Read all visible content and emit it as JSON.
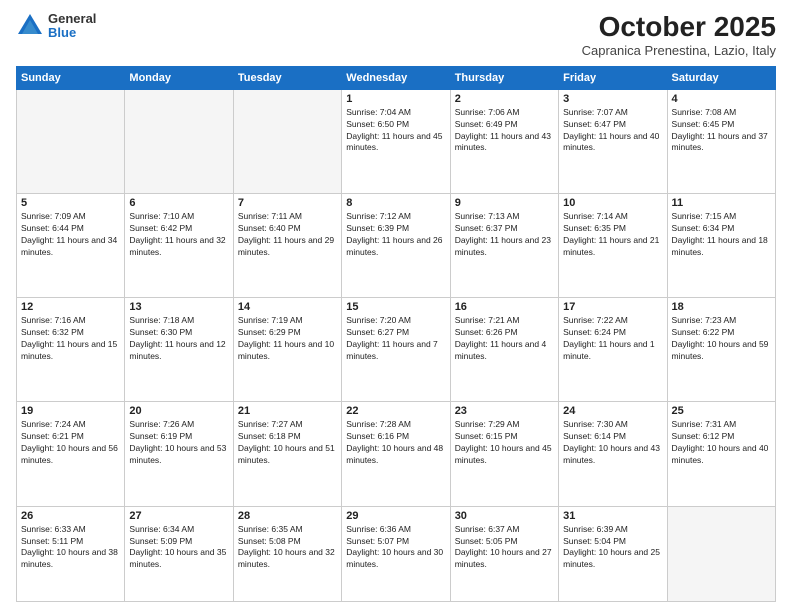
{
  "logo": {
    "general": "General",
    "blue": "Blue"
  },
  "header": {
    "month": "October 2025",
    "location": "Capranica Prenestina, Lazio, Italy"
  },
  "days_of_week": [
    "Sunday",
    "Monday",
    "Tuesday",
    "Wednesday",
    "Thursday",
    "Friday",
    "Saturday"
  ],
  "weeks": [
    [
      {
        "day": "",
        "info": ""
      },
      {
        "day": "",
        "info": ""
      },
      {
        "day": "",
        "info": ""
      },
      {
        "day": "1",
        "info": "Sunrise: 7:04 AM\nSunset: 6:50 PM\nDaylight: 11 hours and 45 minutes."
      },
      {
        "day": "2",
        "info": "Sunrise: 7:06 AM\nSunset: 6:49 PM\nDaylight: 11 hours and 43 minutes."
      },
      {
        "day": "3",
        "info": "Sunrise: 7:07 AM\nSunset: 6:47 PM\nDaylight: 11 hours and 40 minutes."
      },
      {
        "day": "4",
        "info": "Sunrise: 7:08 AM\nSunset: 6:45 PM\nDaylight: 11 hours and 37 minutes."
      }
    ],
    [
      {
        "day": "5",
        "info": "Sunrise: 7:09 AM\nSunset: 6:44 PM\nDaylight: 11 hours and 34 minutes."
      },
      {
        "day": "6",
        "info": "Sunrise: 7:10 AM\nSunset: 6:42 PM\nDaylight: 11 hours and 32 minutes."
      },
      {
        "day": "7",
        "info": "Sunrise: 7:11 AM\nSunset: 6:40 PM\nDaylight: 11 hours and 29 minutes."
      },
      {
        "day": "8",
        "info": "Sunrise: 7:12 AM\nSunset: 6:39 PM\nDaylight: 11 hours and 26 minutes."
      },
      {
        "day": "9",
        "info": "Sunrise: 7:13 AM\nSunset: 6:37 PM\nDaylight: 11 hours and 23 minutes."
      },
      {
        "day": "10",
        "info": "Sunrise: 7:14 AM\nSunset: 6:35 PM\nDaylight: 11 hours and 21 minutes."
      },
      {
        "day": "11",
        "info": "Sunrise: 7:15 AM\nSunset: 6:34 PM\nDaylight: 11 hours and 18 minutes."
      }
    ],
    [
      {
        "day": "12",
        "info": "Sunrise: 7:16 AM\nSunset: 6:32 PM\nDaylight: 11 hours and 15 minutes."
      },
      {
        "day": "13",
        "info": "Sunrise: 7:18 AM\nSunset: 6:30 PM\nDaylight: 11 hours and 12 minutes."
      },
      {
        "day": "14",
        "info": "Sunrise: 7:19 AM\nSunset: 6:29 PM\nDaylight: 11 hours and 10 minutes."
      },
      {
        "day": "15",
        "info": "Sunrise: 7:20 AM\nSunset: 6:27 PM\nDaylight: 11 hours and 7 minutes."
      },
      {
        "day": "16",
        "info": "Sunrise: 7:21 AM\nSunset: 6:26 PM\nDaylight: 11 hours and 4 minutes."
      },
      {
        "day": "17",
        "info": "Sunrise: 7:22 AM\nSunset: 6:24 PM\nDaylight: 11 hours and 1 minute."
      },
      {
        "day": "18",
        "info": "Sunrise: 7:23 AM\nSunset: 6:22 PM\nDaylight: 10 hours and 59 minutes."
      }
    ],
    [
      {
        "day": "19",
        "info": "Sunrise: 7:24 AM\nSunset: 6:21 PM\nDaylight: 10 hours and 56 minutes."
      },
      {
        "day": "20",
        "info": "Sunrise: 7:26 AM\nSunset: 6:19 PM\nDaylight: 10 hours and 53 minutes."
      },
      {
        "day": "21",
        "info": "Sunrise: 7:27 AM\nSunset: 6:18 PM\nDaylight: 10 hours and 51 minutes."
      },
      {
        "day": "22",
        "info": "Sunrise: 7:28 AM\nSunset: 6:16 PM\nDaylight: 10 hours and 48 minutes."
      },
      {
        "day": "23",
        "info": "Sunrise: 7:29 AM\nSunset: 6:15 PM\nDaylight: 10 hours and 45 minutes."
      },
      {
        "day": "24",
        "info": "Sunrise: 7:30 AM\nSunset: 6:14 PM\nDaylight: 10 hours and 43 minutes."
      },
      {
        "day": "25",
        "info": "Sunrise: 7:31 AM\nSunset: 6:12 PM\nDaylight: 10 hours and 40 minutes."
      }
    ],
    [
      {
        "day": "26",
        "info": "Sunrise: 6:33 AM\nSunset: 5:11 PM\nDaylight: 10 hours and 38 minutes."
      },
      {
        "day": "27",
        "info": "Sunrise: 6:34 AM\nSunset: 5:09 PM\nDaylight: 10 hours and 35 minutes."
      },
      {
        "day": "28",
        "info": "Sunrise: 6:35 AM\nSunset: 5:08 PM\nDaylight: 10 hours and 32 minutes."
      },
      {
        "day": "29",
        "info": "Sunrise: 6:36 AM\nSunset: 5:07 PM\nDaylight: 10 hours and 30 minutes."
      },
      {
        "day": "30",
        "info": "Sunrise: 6:37 AM\nSunset: 5:05 PM\nDaylight: 10 hours and 27 minutes."
      },
      {
        "day": "31",
        "info": "Sunrise: 6:39 AM\nSunset: 5:04 PM\nDaylight: 10 hours and 25 minutes."
      },
      {
        "day": "",
        "info": ""
      }
    ]
  ]
}
